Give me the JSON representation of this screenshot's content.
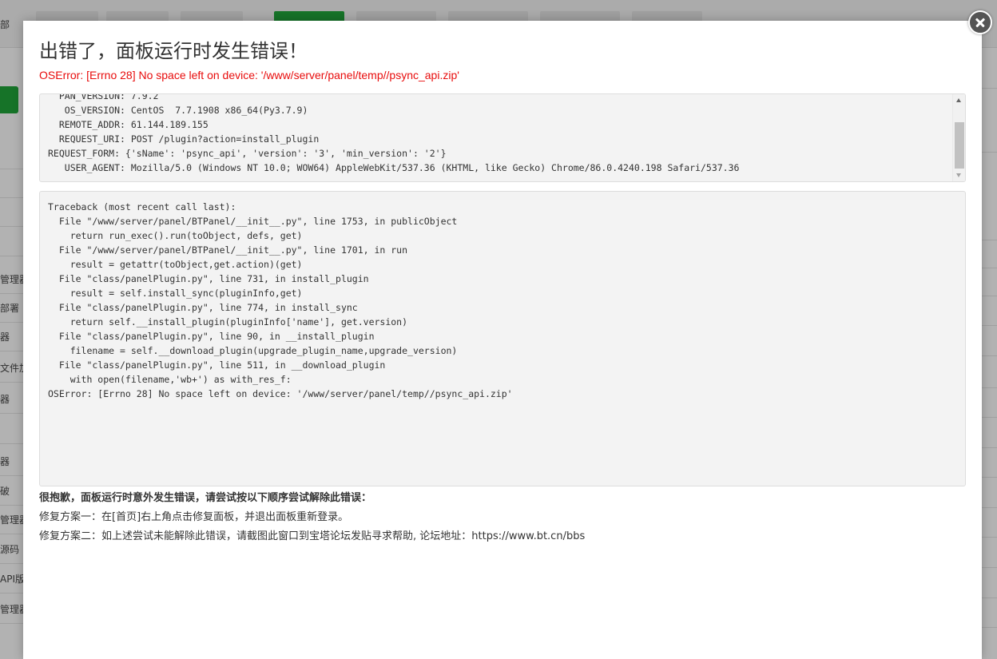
{
  "background": {
    "top_tabs": [
      "",
      "",
      "",
      "",
      "",
      "",
      "",
      ""
    ],
    "top_left_label": "部",
    "sidebar_items": [
      "管理器",
      "部署",
      "器",
      "文件加",
      "器",
      "",
      "器",
      "破",
      "管理器",
      "源码",
      "API版",
      "管理器"
    ]
  },
  "dialog": {
    "title": "出错了，面板运行时发生错误！",
    "error_message": "OSError: [Errno 28] No space left on device: '/www/server/panel/temp//psync_api.zip'",
    "info_lines": [
      "  PAN_VERSION: 7.9.2",
      "   OS_VERSION: CentOS  7.7.1908 x86_64(Py3.7.9)",
      "  REMOTE_ADDR: 61.144.189.155",
      "  REQUEST_URI: POST /plugin?action=install_plugin",
      "REQUEST_FORM: {'sName': 'psync_api', 'version': '3', 'min_version': '2'}",
      "   USER_AGENT: Mozilla/5.0 (Windows NT 10.0; WOW64) AppleWebKit/537.36 (KHTML, like Gecko) Chrome/86.0.4240.198 Safari/537.36"
    ],
    "traceback_lines": [
      "Traceback (most recent call last):",
      "  File \"/www/server/panel/BTPanel/__init__.py\", line 1753, in publicObject",
      "    return run_exec().run(toObject, defs, get)",
      "  File \"/www/server/panel/BTPanel/__init__.py\", line 1701, in run",
      "    result = getattr(toObject,get.action)(get)",
      "  File \"class/panelPlugin.py\", line 731, in install_plugin",
      "    result = self.install_sync(pluginInfo,get)",
      "  File \"class/panelPlugin.py\", line 774, in install_sync",
      "    return self.__install_plugin(pluginInfo['name'], get.version)",
      "  File \"class/panelPlugin.py\", line 90, in __install_plugin",
      "    filename = self.__download_plugin(upgrade_plugin_name,upgrade_version)",
      "  File \"class/panelPlugin.py\", line 511, in __download_plugin",
      "    with open(filename,'wb+') as with_res_f:",
      "OSError: [Errno 28] No space left on device: '/www/server/panel/temp//psync_api.zip'"
    ],
    "help_title": "很抱歉，面板运行时意外发生错误，请尝试按以下顺序尝试解除此错误：",
    "help_lines": [
      "修复方案一：在[首页]右上角点击修复面板，并退出面板重新登录。",
      "修复方案二：如上述尝试未能解除此错误，请截图此窗口到宝塔论坛发贴寻求帮助, 论坛地址：https://www.bt.cn/bbs"
    ],
    "close_icon": "close-icon"
  },
  "colors": {
    "error_red": "#e80c0c",
    "brand_green": "#20a53a"
  }
}
